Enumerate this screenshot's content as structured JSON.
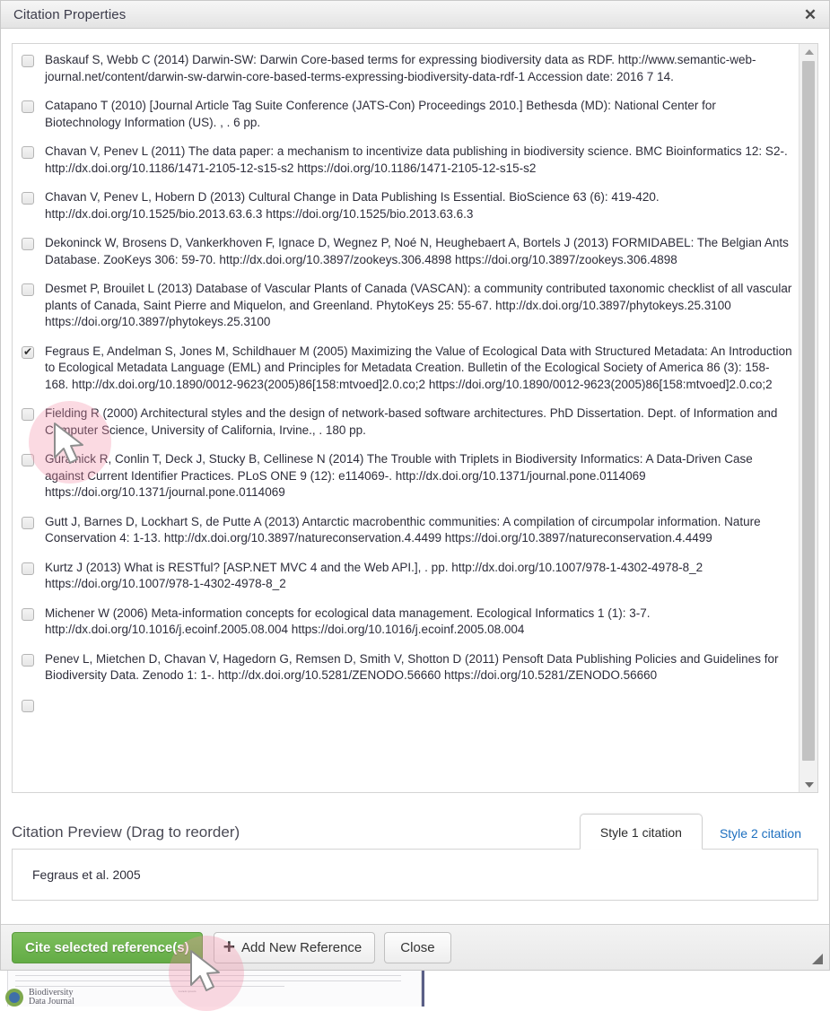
{
  "dialog": {
    "title": "Citation Properties",
    "close_icon": "close-icon"
  },
  "references": [
    {
      "checked": false,
      "text": "Baskauf S, Webb C (2014) Darwin-SW: Darwin Core-based terms for expressing biodiversity data as RDF. http://www.semantic-web-journal.net/content/darwin-sw-darwin-core-based-terms-expressing-biodiversity-data-rdf-1 Accession date: 2016 7 14."
    },
    {
      "checked": false,
      "text": "Catapano T (2010) [Journal Article Tag Suite Conference (JATS-Con) Proceedings 2010.] Bethesda (MD): National Center for Biotechnology Information (US). , . 6 pp."
    },
    {
      "checked": false,
      "text": "Chavan V, Penev L (2011) The data paper: a mechanism to incentivize data publishing in biodiversity science. BMC Bioinformatics 12: S2-. http://dx.doi.org/10.1186/1471-2105-12-s15-s2 https://doi.org/10.1186/1471-2105-12-s15-s2"
    },
    {
      "checked": false,
      "text": "Chavan V, Penev L, Hobern D (2013) Cultural Change in Data Publishing Is Essential. BioScience 63 (6): 419-420. http://dx.doi.org/10.1525/bio.2013.63.6.3 https://doi.org/10.1525/bio.2013.63.6.3"
    },
    {
      "checked": false,
      "text": "Dekoninck W, Brosens D, Vankerkhoven F, Ignace D, Wegnez P, Noé N, Heughebaert A, Bortels J (2013) FORMIDABEL: The Belgian Ants Database. ZooKeys 306: 59-70. http://dx.doi.org/10.3897/zookeys.306.4898 https://doi.org/10.3897/zookeys.306.4898"
    },
    {
      "checked": false,
      "text": "Desmet P, Brouilet L (2013) Database of Vascular Plants of Canada (VASCAN): a community contributed taxonomic checklist of all vascular plants of Canada, Saint Pierre and Miquelon, and Greenland. PhytoKeys 25: 55-67. http://dx.doi.org/10.3897/phytokeys.25.3100 https://doi.org/10.3897/phytokeys.25.3100"
    },
    {
      "checked": true,
      "text": "Fegraus E, Andelman S, Jones M, Schildhauer M (2005) Maximizing the Value of Ecological Data with Structured Metadata: An Introduction to Ecological Metadata Language (EML) and Principles for Metadata Creation. Bulletin of the Ecological Society of America 86 (3): 158-168. http://dx.doi.org/10.1890/0012-9623(2005)86[158:mtvoed]2.0.co;2 https://doi.org/10.1890/0012-9623(2005)86[158:mtvoed]2.0.co;2"
    },
    {
      "checked": false,
      "text": "Fielding R (2000) Architectural styles and the design of network-based software architectures. PhD Dissertation. Dept. of Information and Computer Science, University of California, Irvine., . 180 pp."
    },
    {
      "checked": false,
      "text": "Guralnick R, Conlin T, Deck J, Stucky B, Cellinese N (2014) The Trouble with Triplets in Biodiversity Informatics: A Data-Driven Case against Current Identifier Practices. PLoS ONE 9 (12): e114069-. http://dx.doi.org/10.1371/journal.pone.0114069 https://doi.org/10.1371/journal.pone.0114069"
    },
    {
      "checked": false,
      "text": "Gutt J, Barnes D, Lockhart S, de Putte A (2013) Antarctic macrobenthic communities: A compilation of circumpolar information. Nature Conservation 4: 1-13. http://dx.doi.org/10.3897/natureconservation.4.4499 https://doi.org/10.3897/natureconservation.4.4499"
    },
    {
      "checked": false,
      "text": "Kurtz J (2013) What is RESTful? [ASP.NET MVC 4 and the Web API.], . pp. http://dx.doi.org/10.1007/978-1-4302-4978-8_2 https://doi.org/10.1007/978-1-4302-4978-8_2"
    },
    {
      "checked": false,
      "text": "Michener W (2006) Meta-information concepts for ecological data management. Ecological Informatics 1 (1): 3-7. http://dx.doi.org/10.1016/j.ecoinf.2005.08.004 https://doi.org/10.1016/j.ecoinf.2005.08.004"
    },
    {
      "checked": false,
      "text": "Penev L, Mietchen D, Chavan V, Hagedorn G, Remsen D, Smith V, Shotton D (2011) Pensoft Data Publishing Policies and Guidelines for Biodiversity Data. Zenodo 1: 1-. http://dx.doi.org/10.5281/ZENODO.56660 https://doi.org/10.5281/ZENODO.56660"
    }
  ],
  "preview": {
    "title": "Citation Preview (Drag to reorder)",
    "citation": "Fegraus et al. 2005",
    "tabs": [
      {
        "label": "Style 1 citation",
        "active": true
      },
      {
        "label": "Style 2 citation",
        "active": false
      }
    ]
  },
  "footer": {
    "cite_label": "Cite selected reference(s)",
    "add_label": "Add New Reference",
    "close_label": "Close",
    "add_icon": "plus-icon",
    "resize_icon": "resize-grip-icon"
  },
  "background": {
    "brand_line1": "Biodiversity",
    "brand_line2": "Data Journal",
    "doc_caption": "Lorem ipsum"
  },
  "colors": {
    "cite_button": "#63ac45",
    "tab_link": "#1d6fbf",
    "text": "#2d2d3a",
    "cursor_highlight": "#f28ca6"
  }
}
